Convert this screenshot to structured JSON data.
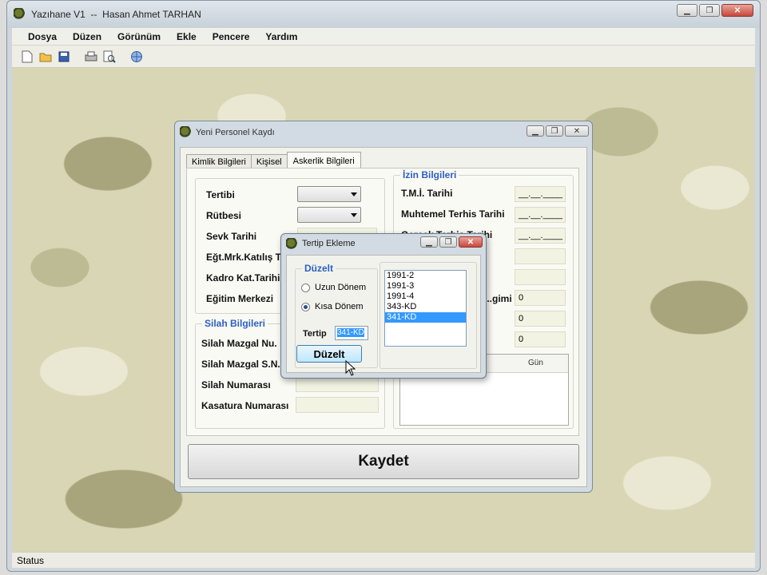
{
  "app": {
    "title": "Yazıhane V1  --  Hasan Ahmet TARHAN",
    "status": "Status"
  },
  "menu": [
    "Dosya",
    "Düzen",
    "Görünüm",
    "Ekle",
    "Pencere",
    "Yardım"
  ],
  "toolbar": [
    "new-icon",
    "open-folder-icon",
    "save-icon",
    "print-icon",
    "print-preview-icon",
    "globe-icon"
  ],
  "personel": {
    "title": "Yeni Personel Kaydı",
    "tabs": [
      "Kimlik Bilgileri",
      "Kişisel",
      "Askerlik Bilgileri"
    ],
    "left_labels": [
      "Tertibi",
      "Rütbesi",
      "Sevk Tarihi",
      "Eğt.Mrk.Katılış Tarihi",
      "Kadro Kat.Tarihi",
      "Eğitim Merkezi"
    ],
    "silah_title": "Silah Bilgileri",
    "silah_labels": [
      "Silah Mazgal Nu.",
      "Silah Mazgal S.N.",
      "Silah Numarası",
      "Kasatura Numarası"
    ],
    "izin_title": "İzin Bilgileri",
    "izin_labels": [
      "T.M.İ. Tarihi",
      "Muhtemel Terhis Tarihi",
      "Gerçek Terhis Tarihi",
      "",
      "",
      "...gimi",
      "",
      ""
    ],
    "date_placeholder": "__.__.____",
    "zero": "0",
    "grid_header": "Gün",
    "save_label": "Kaydet"
  },
  "tertip": {
    "title": "Tertip Ekleme",
    "group": "Düzelt",
    "radio1": "Uzun Dönem",
    "radio2": "Kısa Dönem",
    "tertip_label": "Tertip",
    "tertip_value": "341-KD",
    "list": [
      "1991-2",
      "1991-3",
      "1991-4",
      "343-KD",
      "341-KD"
    ],
    "button": "Düzelt"
  }
}
